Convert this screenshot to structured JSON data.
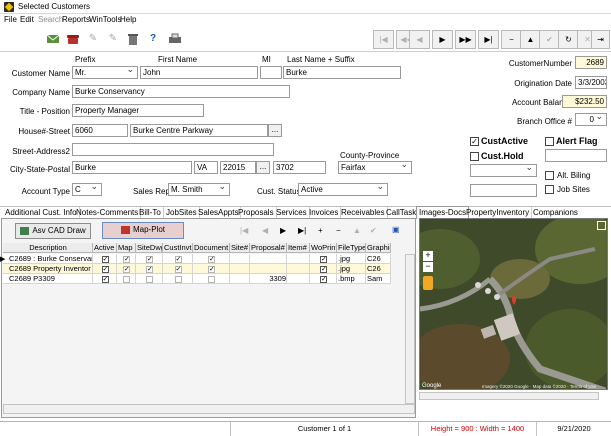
{
  "window": {
    "title": "Selected Customers"
  },
  "menu": [
    "File",
    "Edit",
    "Search",
    "Reports",
    "WinTools",
    "Help"
  ],
  "menu_disabled": [
    "Search"
  ],
  "toolbar_icons": [
    "email-icon",
    "phone-icon",
    "wrench-icon",
    "tools-icon",
    "trash-icon",
    "help-icon",
    "print-icon"
  ],
  "nav_buttons": [
    "first",
    "prev-page",
    "prev",
    "next",
    "next-page",
    "last",
    "add",
    "delete",
    "edit",
    "save",
    "refresh",
    "cancel",
    "exit"
  ],
  "form": {
    "prefix_label": "Prefix",
    "first_name_label": "First Name",
    "mi_label": "MI",
    "last_name_label": "Last Name + Suffix",
    "customer_name_label": "Customer Name",
    "prefix": "Mr.",
    "first_name": "John",
    "mi": "",
    "last_name": "Burke",
    "company_name_label": "Company Name",
    "company_name": "Burke Conservancy",
    "title_label": "Title - Position",
    "title": "Property Manager",
    "house_street_label": "House#-Street",
    "house_no": "6060",
    "street": "Burke Centre Parkway",
    "street2_label": "Street-Address2",
    "street2": "",
    "city_state_label": "City-State-Postal",
    "city": "Burke",
    "state": "VA",
    "zip": "22015",
    "zip_ext": "3702",
    "county_label": "County-Province",
    "county": "Fairfax",
    "account_type_label": "Account Type",
    "account_type": "C",
    "sales_rep_label": "Sales Rep",
    "sales_rep": "M. Smith",
    "cust_status_label": "Cust. Status",
    "cust_status": "Active",
    "customer_number_label": "CustomerNumber",
    "customer_number": "2689",
    "origination_date_label": "Origination Date",
    "origination_date": "3/3/2003",
    "account_balance_label": "Account Balance",
    "account_balance": "$232.50",
    "branch_office_label": "Branch Office #",
    "branch_office": "0",
    "cust_active_label": "CustActive",
    "cust_active_checked": "✓",
    "alert_flag_label": "Alert Flag",
    "cust_hold_label": "Cust.Hold",
    "alt_billing_label": "Alt. Biling",
    "job_sites_label": "Job Sites",
    "ellipsis": "..."
  },
  "tabs": [
    "Additional Cust. Info",
    "Notes-Comments",
    "Bill-To",
    "JobSites",
    "SalesAppts",
    "Proposals",
    "Services",
    "Invoices",
    "Receivables",
    "CallTask",
    "Images-Docs",
    "PropertyInventory",
    "Companions"
  ],
  "active_tab": "Images-Docs",
  "images_panel": {
    "asv_cad_draw_label": "Asv CAD Draw",
    "map_plot_label": "Map-Plot",
    "columns": [
      "Description",
      "Active",
      "Map",
      "SiteDwg",
      "CustInvt",
      "Document",
      "Site#",
      "Proposal#",
      "Item#",
      "WoPrint",
      "FileType",
      "Graphic"
    ],
    "rows": [
      {
        "description": "C2689 : Burke Conservan",
        "active": "✓",
        "map": "✓",
        "sitedwg": "✓",
        "custinvt": "✓",
        "document": "✓",
        "site": "",
        "proposal": "",
        "item": "",
        "woprint": "✓",
        "filetype": ".jpg",
        "graphic": "C26"
      },
      {
        "description": "C2689 Property Inventor",
        "active": "✓",
        "map": "✓",
        "sitedwg": "✓",
        "custinvt": "✓",
        "document": "✓",
        "site": "",
        "proposal": "",
        "item": "",
        "woprint": "✓",
        "filetype": ".jpg",
        "graphic": "C26"
      },
      {
        "description": "C2689 P3309",
        "active": "✓",
        "map": "",
        "sitedwg": "",
        "custinvt": "",
        "document": "",
        "site": "",
        "proposal": "3309",
        "item": "",
        "woprint": "✓",
        "filetype": ".bmp",
        "graphic": "Sam"
      }
    ]
  },
  "map": {
    "attribution_left": "Google",
    "attribution_right": "Imagery ©2020 Google · Map data ©2020 · Terms of Use",
    "zoom_in": "+",
    "zoom_out": "−"
  },
  "status": {
    "record": "Customer 1 of 1",
    "dimensions": "Height = 900 : Width = 1400",
    "date": "9/21/2020"
  },
  "colors": {
    "field_yellow": "#fff9d8",
    "status_red": "#cc0000",
    "map_button": "#e7cfcf"
  }
}
